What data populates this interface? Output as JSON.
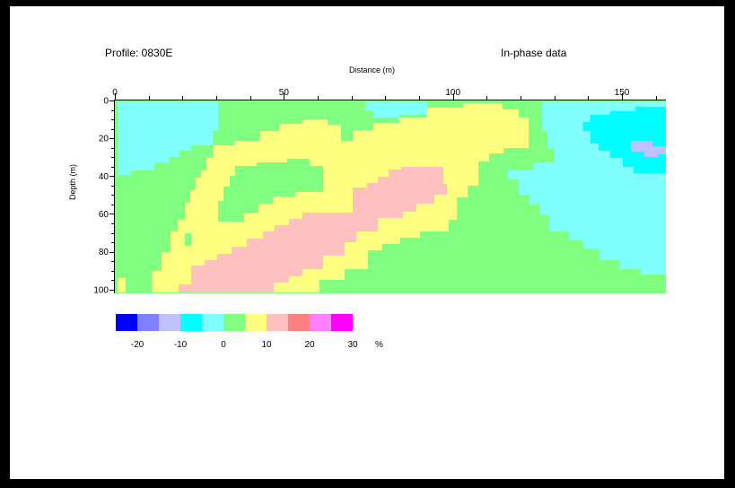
{
  "header": {
    "profile_title": "Profile: 0830E",
    "data_title": "In-phase data"
  },
  "chart_data": {
    "type": "heatmap",
    "title": "In-phase data",
    "subtitle": "Profile: 0830E",
    "xlabel": "Distance (m)",
    "ylabel": "Depth (m)",
    "xlim": [
      0,
      163
    ],
    "ylim": [
      0,
      102
    ],
    "y_inverted": true,
    "x_axis_position": "top",
    "x_ticks": [
      0,
      50,
      100,
      150
    ],
    "y_ticks": [
      0,
      20,
      40,
      60,
      80,
      100
    ],
    "grid": false,
    "unit": "%",
    "colorbar": {
      "position": "bottom-left",
      "bins": [
        {
          "from": -25,
          "to": -20,
          "color": "#0000ff"
        },
        {
          "from": -20,
          "to": -15,
          "color": "#8080ff"
        },
        {
          "from": -15,
          "to": -10,
          "color": "#c0c0ff"
        },
        {
          "from": -10,
          "to": -5,
          "color": "#00ffff"
        },
        {
          "from": -5,
          "to": 0,
          "color": "#80ffff"
        },
        {
          "from": 0,
          "to": 5,
          "color": "#80ff80"
        },
        {
          "from": 5,
          "to": 10,
          "color": "#ffff80"
        },
        {
          "from": 10,
          "to": 15,
          "color": "#ffc0c0"
        },
        {
          "from": 15,
          "to": 20,
          "color": "#ff8080"
        },
        {
          "from": 20,
          "to": 25,
          "color": "#ff80ff"
        },
        {
          "from": 25,
          "to": 30,
          "color": "#ff00ff"
        }
      ],
      "labels": [
        "-20",
        "-10",
        "0",
        "10",
        "20",
        "30"
      ],
      "unit_label": "%"
    },
    "regions": [
      {
        "name": "shallow-left",
        "value_range": [
          -5,
          0
        ],
        "color": "#80ffff",
        "x": [
          1,
          30
        ],
        "depth": [
          0,
          35
        ]
      },
      {
        "name": "top-middle",
        "value_range": [
          -5,
          0
        ],
        "color": "#80ffff",
        "x": [
          74,
          93
        ],
        "depth": [
          0,
          8
        ]
      },
      {
        "name": "right-zone",
        "value_range": [
          -5,
          0
        ],
        "color": "#80ffff",
        "x": [
          117,
          163
        ],
        "depth": [
          5,
          95
        ]
      },
      {
        "name": "right-core",
        "value_range": [
          -10,
          -5
        ],
        "color": "#00ffff",
        "x": [
          140,
          163
        ],
        "depth": [
          5,
          38
        ]
      },
      {
        "name": "right-min",
        "value_range": [
          -15,
          -10
        ],
        "color": "#c0c0ff",
        "x": [
          153,
          163
        ],
        "depth": [
          21,
          27
        ]
      },
      {
        "name": "diagonal-band",
        "value_range": [
          5,
          10
        ],
        "color": "#ffff80",
        "x": [
          1,
          123
        ],
        "depth": [
          5,
          102
        ]
      },
      {
        "name": "diagonal-core",
        "value_range": [
          10,
          15
        ],
        "color": "#ffc0c0",
        "x": [
          19,
          99
        ],
        "depth": [
          35,
          102
        ]
      }
    ]
  }
}
